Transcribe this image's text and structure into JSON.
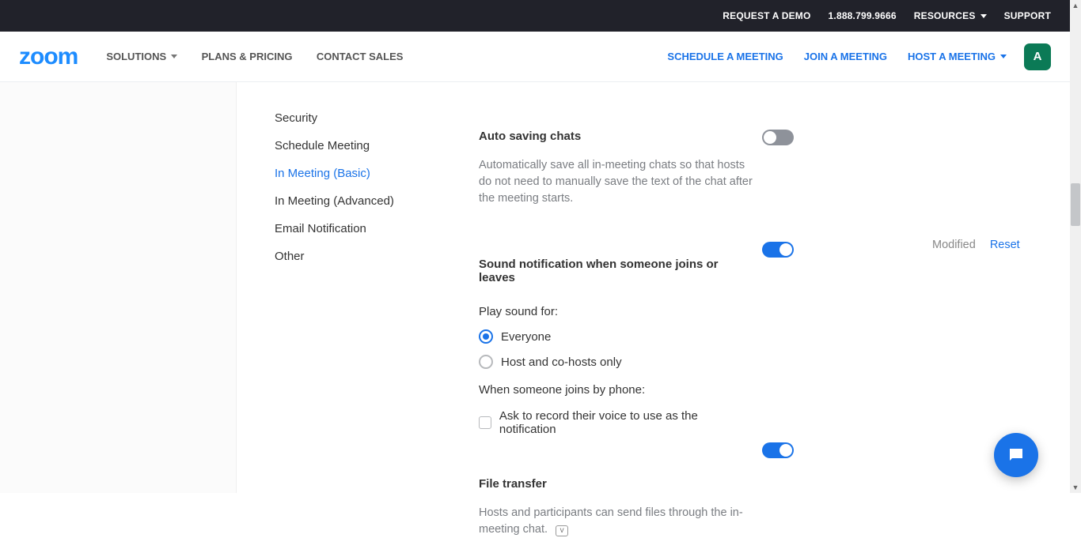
{
  "topbar": {
    "request_demo": "REQUEST A DEMO",
    "phone": "1.888.799.9666",
    "resources": "RESOURCES",
    "support": "SUPPORT"
  },
  "header": {
    "logo": "zoom",
    "solutions": "SOLUTIONS",
    "plans": "PLANS & PRICING",
    "contact": "CONTACT SALES",
    "schedule": "SCHEDULE A MEETING",
    "join": "JOIN A MEETING",
    "host": "HOST A MEETING",
    "avatar": "A"
  },
  "tabs": {
    "items": [
      {
        "label": "Security"
      },
      {
        "label": "Schedule Meeting"
      },
      {
        "label": "In Meeting (Basic)"
      },
      {
        "label": "In Meeting (Advanced)"
      },
      {
        "label": "Email Notification"
      },
      {
        "label": "Other"
      }
    ]
  },
  "settings": {
    "auto_save": {
      "title": "Auto saving chats",
      "desc": "Automatically save all in-meeting chats so that hosts do not need to manually save the text of the chat after the meeting starts.",
      "on": false
    },
    "sound": {
      "title": "Sound notification when someone joins or leaves",
      "on": true,
      "modified": "Modified",
      "reset": "Reset",
      "play_label": "Play sound for:",
      "opt_everyone": "Everyone",
      "opt_host": "Host and co-hosts only",
      "phone_label": "When someone joins by phone:",
      "record_voice": "Ask to record their voice to use as the notification"
    },
    "file": {
      "title": "File transfer",
      "desc": "Hosts and participants can send files through the in-meeting chat.",
      "on": true
    }
  }
}
